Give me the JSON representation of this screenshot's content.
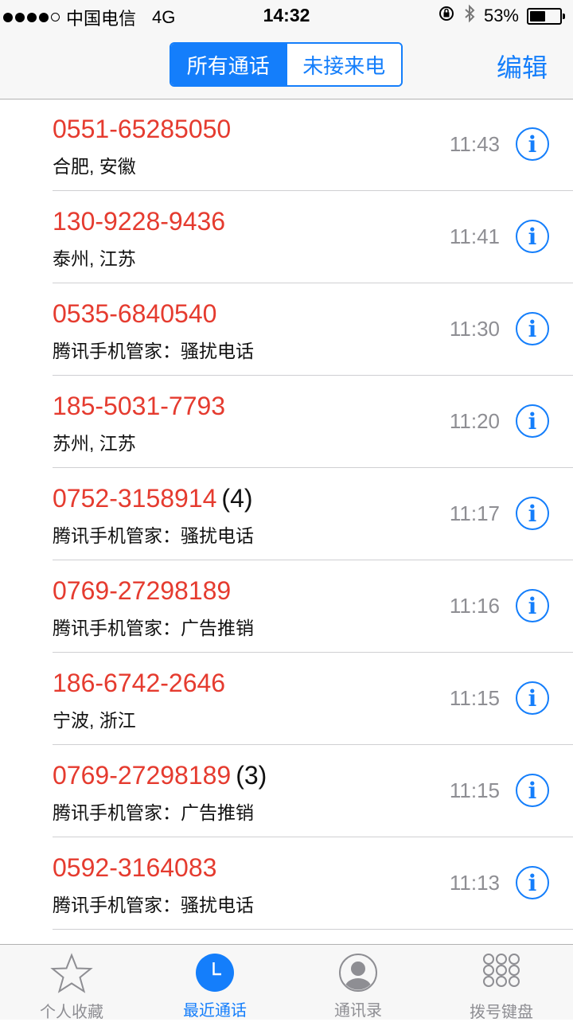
{
  "status_bar": {
    "carrier": "中国电信",
    "network": "4G",
    "time": "14:32",
    "battery_percent": "53%",
    "battery_level": 0.53
  },
  "nav": {
    "segments": [
      "所有通话",
      "未接来电"
    ],
    "selected_segment": "所有通话",
    "edit_label": "编辑"
  },
  "calls": [
    {
      "number": "0551-65285050",
      "count": "",
      "location": "合肥, 安徽",
      "time": "11:43"
    },
    {
      "number": "130-9228-9436",
      "count": "",
      "location": "泰州, 江苏",
      "time": "11:41"
    },
    {
      "number": "0535-6840540",
      "count": "",
      "location": "腾讯手机管家：骚扰电话",
      "time": "11:30"
    },
    {
      "number": "185-5031-7793",
      "count": "",
      "location": "苏州, 江苏",
      "time": "11:20"
    },
    {
      "number": "0752-3158914",
      "count": "(4)",
      "location": "腾讯手机管家：骚扰电话",
      "time": "11:17"
    },
    {
      "number": "0769-27298189",
      "count": "",
      "location": "腾讯手机管家：广告推销",
      "time": "11:16"
    },
    {
      "number": "186-6742-2646",
      "count": "",
      "location": "宁波, 浙江",
      "time": "11:15"
    },
    {
      "number": "0769-27298189",
      "count": "(3)",
      "location": "腾讯手机管家：广告推销",
      "time": "11:15"
    },
    {
      "number": "0592-3164083",
      "count": "",
      "location": "腾讯手机管家：骚扰电话",
      "time": "11:13"
    }
  ],
  "tabs": [
    {
      "label": "个人收藏",
      "icon": "star-icon",
      "active": false
    },
    {
      "label": "最近通话",
      "icon": "clock-icon",
      "active": true
    },
    {
      "label": "通讯录",
      "icon": "contact-icon",
      "active": false
    },
    {
      "label": "拨号键盘",
      "icon": "keypad-icon",
      "active": false
    }
  ],
  "colors": {
    "accent": "#147efb",
    "missed_call_red": "#e53b2f",
    "secondary_gray": "#8e8e93"
  }
}
